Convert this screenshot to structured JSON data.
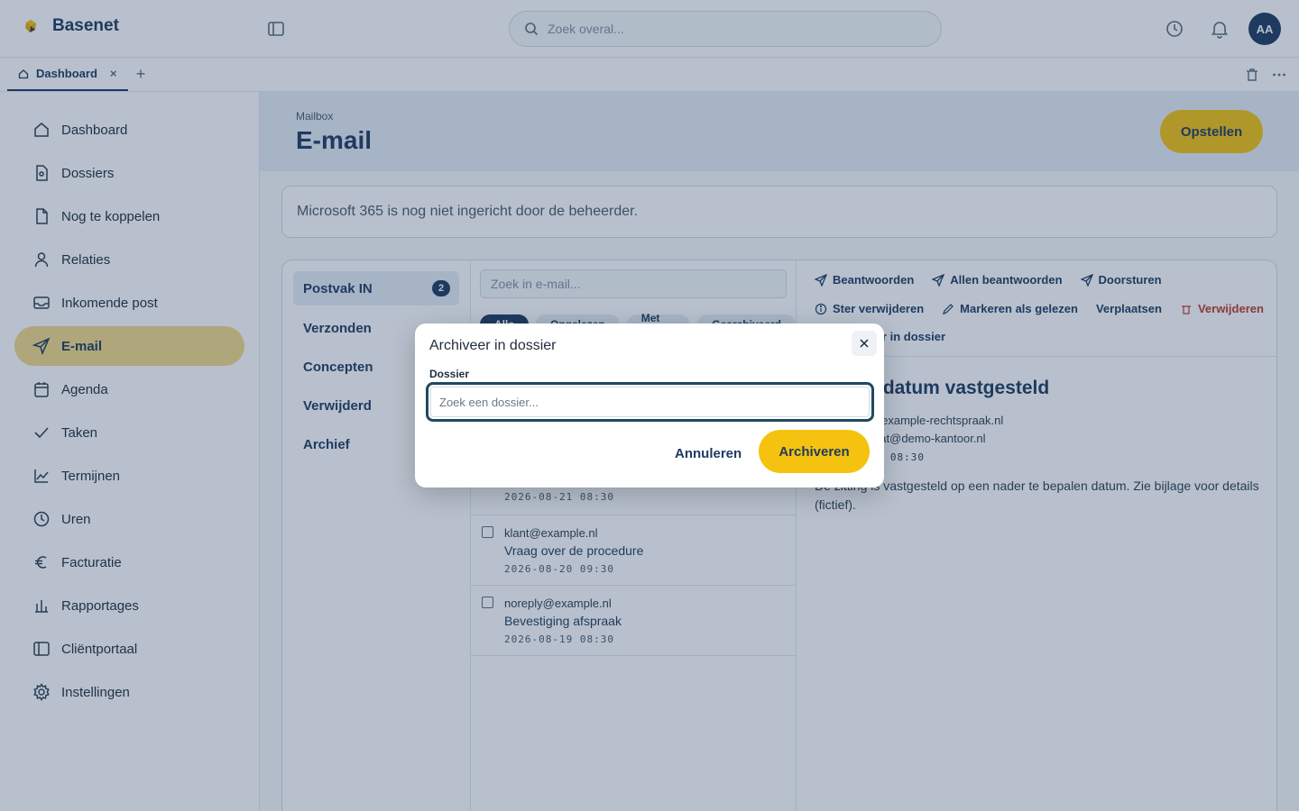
{
  "app": {
    "name": "Basenet",
    "avatar_initials": "AA"
  },
  "colors": {
    "brand_navy": "#1e3a5f",
    "accent_yellow": "#f5c30f",
    "nav_active": "#f5d98a",
    "danger": "#c0392b"
  },
  "search": {
    "placeholder": "Zoek overal..."
  },
  "tabs": [
    {
      "label": "Dashboard",
      "icon": "home-icon"
    }
  ],
  "sidebar": {
    "items": [
      {
        "label": "Dashboard",
        "icon": "home-icon"
      },
      {
        "label": "Dossiers",
        "icon": "file-document-icon"
      },
      {
        "label": "Nog te koppelen",
        "icon": "file-icon"
      },
      {
        "label": "Relaties",
        "icon": "user-icon"
      },
      {
        "label": "Inkomende post",
        "icon": "inbox-icon"
      },
      {
        "label": "E-mail",
        "icon": "send-icon",
        "active": true
      },
      {
        "label": "Agenda",
        "icon": "calendar-icon"
      },
      {
        "label": "Taken",
        "icon": "check-icon"
      },
      {
        "label": "Termijnen",
        "icon": "line-chart-icon"
      },
      {
        "label": "Uren",
        "icon": "clock-icon"
      },
      {
        "label": "Facturatie",
        "icon": "euro-icon"
      },
      {
        "label": "Rapportages",
        "icon": "bar-chart-icon"
      },
      {
        "label": "Cliëntportaal",
        "icon": "portal-icon"
      },
      {
        "label": "Instellingen",
        "icon": "gear-icon"
      }
    ]
  },
  "header": {
    "breadcrumb": "Mailbox",
    "title": "E-mail",
    "compose_label": "Opstellen"
  },
  "notice": "Microsoft 365 is nog niet ingericht door de beheerder.",
  "folders": [
    {
      "label": "Postvak IN",
      "count": "2",
      "active": true
    },
    {
      "label": "Verzonden"
    },
    {
      "label": "Concepten"
    },
    {
      "label": "Verwijderd"
    },
    {
      "label": "Archief"
    }
  ],
  "list": {
    "search_placeholder": "Zoek in e-mail...",
    "filters": [
      "Alle",
      "Ongelezen",
      "Met ster",
      "Gearchiveerd"
    ],
    "partial_date": "2026-08-21 08:30",
    "items": [
      {
        "from": "klant@example.nl",
        "subject": "Vraag over de procedure",
        "date": "2026-08-20 09:30"
      },
      {
        "from": "noreply@example.nl",
        "subject": "Bevestiging afspraak",
        "date": "2026-08-19 08:30"
      }
    ]
  },
  "reader": {
    "actions_row1": [
      "Beantwoorden",
      "Allen beantwoorden",
      "Doorsturen"
    ],
    "actions_row2": [
      "Ster verwijderen",
      "Markeren als gelezen",
      "Verplaatsen",
      "Verwijderen"
    ],
    "action_archive": "Archiveer in dossier",
    "subject": "Zittingsdatum vastgesteld",
    "from": "Van: griffie@example-rechtspraak.nl",
    "to": "Aan: advocaat@demo-kantoor.nl",
    "date": "2026-08-22 08:30",
    "body": "De zitting is vastgesteld op een nader te bepalen datum. Zie bijlage voor details (fictief)."
  },
  "dialog": {
    "title": "Archiveer in dossier",
    "field_label": "Dossier",
    "field_placeholder": "Zoek een dossier...",
    "cancel_label": "Annuleren",
    "confirm_label": "Archiveren"
  }
}
